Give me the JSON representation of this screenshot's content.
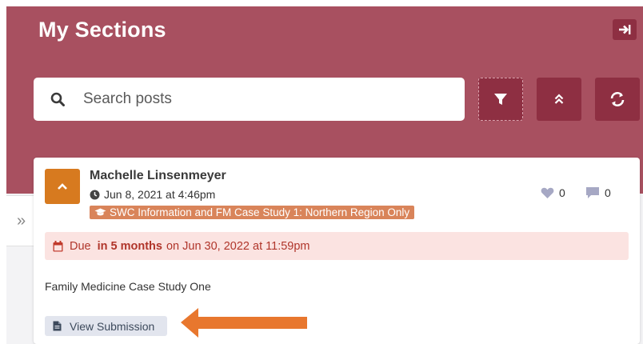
{
  "header": {
    "title": "My Sections"
  },
  "search": {
    "placeholder": "Search posts"
  },
  "toolbar": {
    "filter_icon": "filter-icon",
    "collapse_icon": "double-chevron-up-icon",
    "refresh_icon": "refresh-icon",
    "exit_icon": "arrow-to-right-icon"
  },
  "sidebar_toggle": {
    "glyph": "»"
  },
  "post": {
    "author": "Machelle Linsenmeyer",
    "date": "Jun 8, 2021 at 4:46pm",
    "tag": "SWC Information and FM Case Study 1: Northern Region Only",
    "likes": "0",
    "comments": "0",
    "due": {
      "prefix": "Due",
      "relative": "in 5 months",
      "absolute": "on Jun 30, 2022 at 11:59pm"
    },
    "description": "Family Medicine Case Study One",
    "action_label": "View Submission"
  },
  "colors": {
    "header_bg": "#a85060",
    "button_bg": "#8e2f42",
    "expand_btn": "#d77a1f",
    "tag_bg": "#d9845a",
    "due_bg": "#fbe3e1",
    "due_text": "#b0352a",
    "arrow": "#e8772e"
  }
}
